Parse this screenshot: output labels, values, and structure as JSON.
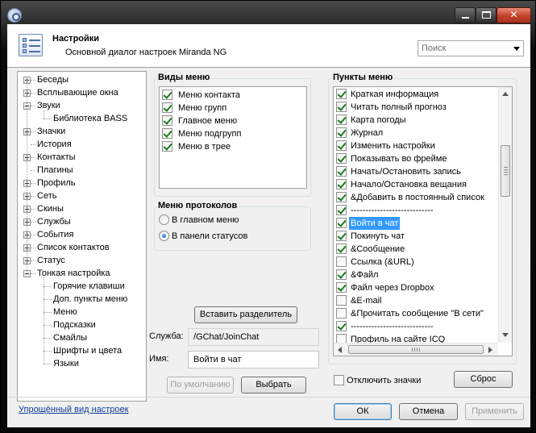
{
  "window": {
    "title": "Настройки",
    "subtitle": "Основной диалог настроек Miranda NG"
  },
  "search": {
    "placeholder": "Поиск"
  },
  "tree": {
    "items": [
      {
        "label": "Беседы",
        "level": 0,
        "expander": "plus"
      },
      {
        "label": "Всплывающие окна",
        "level": 0,
        "expander": "plus"
      },
      {
        "label": "Звуки",
        "level": 0,
        "expander": "minus"
      },
      {
        "label": "Библиотека BASS",
        "level": 1,
        "expander": ""
      },
      {
        "label": "Значки",
        "level": 0,
        "expander": "plus"
      },
      {
        "label": "История",
        "level": 0,
        "expander": ""
      },
      {
        "label": "Контакты",
        "level": 0,
        "expander": "plus"
      },
      {
        "label": "Плагины",
        "level": 0,
        "expander": ""
      },
      {
        "label": "Профиль",
        "level": 0,
        "expander": "plus"
      },
      {
        "label": "Сеть",
        "level": 0,
        "expander": "plus"
      },
      {
        "label": "Скины",
        "level": 0,
        "expander": "plus"
      },
      {
        "label": "Службы",
        "level": 0,
        "expander": "plus"
      },
      {
        "label": "События",
        "level": 0,
        "expander": "plus"
      },
      {
        "label": "Список контактов",
        "level": 0,
        "expander": "plus"
      },
      {
        "label": "Статус",
        "level": 0,
        "expander": "plus"
      },
      {
        "label": "Тонкая настройка",
        "level": 0,
        "expander": "minus"
      },
      {
        "label": "Горячие клавиши",
        "level": 1,
        "expander": ""
      },
      {
        "label": "Доп. пункты меню",
        "level": 1,
        "expander": ""
      },
      {
        "label": "Меню",
        "level": 1,
        "expander": ""
      },
      {
        "label": "Подсказки",
        "level": 1,
        "expander": ""
      },
      {
        "label": "Смайлы",
        "level": 1,
        "expander": ""
      },
      {
        "label": "Шрифты и цвета",
        "level": 1,
        "expander": ""
      },
      {
        "label": "Языки",
        "level": 1,
        "expander": ""
      }
    ]
  },
  "menu_types": {
    "title": "Виды меню",
    "items": [
      {
        "label": "Меню контакта",
        "checked": true
      },
      {
        "label": "Меню групп",
        "checked": true
      },
      {
        "label": "Главное меню",
        "checked": true
      },
      {
        "label": "Меню подгрупп",
        "checked": true
      },
      {
        "label": "Меню в трее",
        "checked": true
      }
    ]
  },
  "protocol_menu": {
    "title": "Меню протоколов",
    "options": [
      {
        "label": "В главном меню",
        "selected": false
      },
      {
        "label": "В панели статусов",
        "selected": true
      }
    ]
  },
  "insert_separator_label": "Вставить разделитель",
  "service": {
    "label": "Служба:",
    "value": "/GChat/JoinChat"
  },
  "name": {
    "label": "Имя:",
    "value": "Войти в чат"
  },
  "default_label": "По умолчанию",
  "choose_label": "Выбрать",
  "menu_items": {
    "title": "Пункты меню",
    "items": [
      {
        "label": "Краткая информация",
        "checked": true
      },
      {
        "label": "Читать полный прогноз",
        "checked": true
      },
      {
        "label": "Карта погоды",
        "checked": true
      },
      {
        "label": "Журнал",
        "checked": true
      },
      {
        "label": "Изменить настройки",
        "checked": true
      },
      {
        "label": "Показывать во фрейме",
        "checked": true
      },
      {
        "label": "Начать/Остановить запись",
        "checked": true
      },
      {
        "label": "Начало/Остановка вещания",
        "checked": true
      },
      {
        "label": "&Добавить в постоянный список",
        "checked": true
      },
      {
        "label": "----------------------------",
        "checked": true
      },
      {
        "label": "Войти в чат",
        "checked": true,
        "selected": true
      },
      {
        "label": "Покинуть чат",
        "checked": true
      },
      {
        "label": "&Сообщение",
        "checked": true
      },
      {
        "label": "Ссылка (&URL)",
        "checked": false
      },
      {
        "label": "&Файл",
        "checked": true
      },
      {
        "label": "Файл через Dropbox",
        "checked": true
      },
      {
        "label": "&E-mail",
        "checked": false
      },
      {
        "label": "&Прочитать сообщение \"В сети\"",
        "checked": false
      },
      {
        "label": "----------------------------",
        "checked": true
      },
      {
        "label": "Профиль на сайте ICQ",
        "checked": false
      }
    ]
  },
  "disable_icons": {
    "label": "Отключить значки",
    "checked": false
  },
  "reset_label": "Сброс",
  "simple_view_link": "Упрощённый вид настроек",
  "ok_label": "ОК",
  "cancel_label": "Отмена",
  "apply_label": "Применить"
}
